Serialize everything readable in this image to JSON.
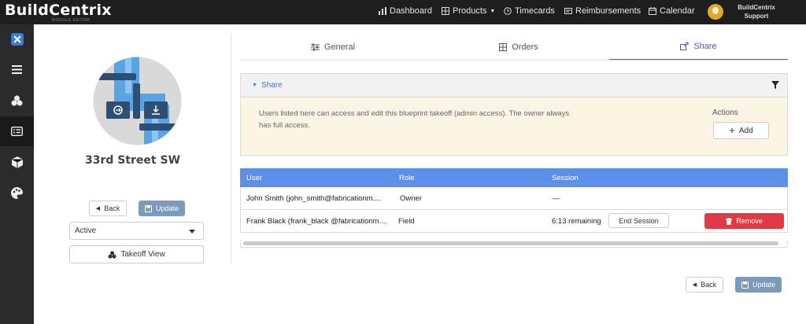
{
  "app": {
    "logo": "BuildCentrix",
    "logo_sub": "MODULE EDITOR"
  },
  "nav": {
    "items": [
      {
        "label": "Dashboard",
        "icon": "bar-chart-icon"
      },
      {
        "label": "Products",
        "icon": "grid-icon"
      },
      {
        "label": "Timecards",
        "icon": "clock-icon"
      },
      {
        "label": "Reimbursements",
        "icon": "receipt-icon"
      },
      {
        "label": "Calendar",
        "icon": "calendar-icon"
      }
    ],
    "user_line1": "BuildCentrix",
    "user_line2": "Support"
  },
  "sidebar": {
    "items": [
      {
        "icon": "close-x-icon"
      },
      {
        "icon": "menu-icon"
      },
      {
        "icon": "takeoff-icon"
      },
      {
        "icon": "list-card-icon"
      },
      {
        "icon": "cube-icon"
      },
      {
        "icon": "palette-icon"
      }
    ]
  },
  "project": {
    "title": "33rd Street SW",
    "back_label": "Back",
    "update_label": "Update",
    "status_value": "Active",
    "takeoff_view_label": "Takeoff View"
  },
  "tabs": [
    {
      "label": "General",
      "icon": "sliders-icon"
    },
    {
      "label": "Orders",
      "icon": "table-icon"
    },
    {
      "label": "Share",
      "icon": "share-icon"
    }
  ],
  "share": {
    "title": "Share",
    "description": "Users listed here can access and edit this blueprint takeoff (admin access). The owner always has full access.",
    "actions_label": "Actions",
    "add_label": "Add"
  },
  "table": {
    "columns": [
      "User",
      "Role",
      "Session"
    ],
    "rows": [
      {
        "user": "John Smith (john_smith@fabricationm....",
        "role": "Owner",
        "session": "—"
      },
      {
        "user": "Frank Black (frank_black @fabricationm....",
        "role": "Field",
        "session": "6:13 remaining",
        "end_session_label": "End Session",
        "remove_label": "Remove"
      }
    ]
  },
  "footer": {
    "back_label": "Back",
    "update_label": "Update"
  },
  "colors": {
    "accent": "#6a4bc4",
    "table_header": "#5b8fe8",
    "danger": "#e03a45",
    "primary_button": "#7c9bbb"
  }
}
